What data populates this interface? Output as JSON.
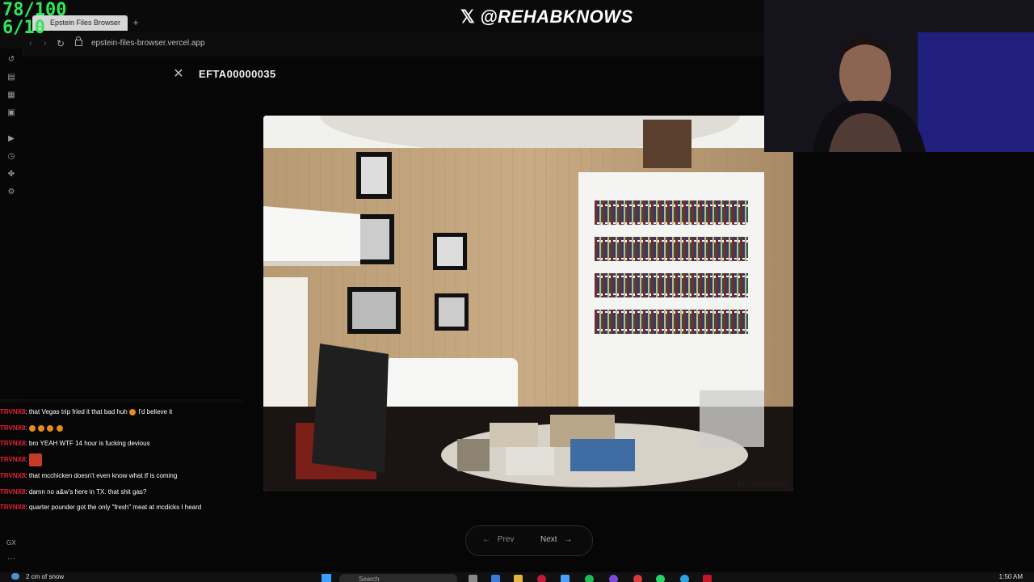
{
  "overlay": {
    "score_line1": "78/100",
    "score_line2": "6/10",
    "social_handle": "@REHABKNOWS",
    "social_icon": "x-logo-icon"
  },
  "browser": {
    "tab_title": "Epstein Files Browser",
    "new_tab": "+",
    "url": "epstein-files-browser.vercel.app"
  },
  "viewer": {
    "document_id": "EFTA00000035",
    "close_symbol": "✕",
    "photo_caption": "EFTA00000035",
    "prev_arrow": "←",
    "prev_label": "Prev",
    "next_label": "Next",
    "next_arrow": "→"
  },
  "chat": {
    "messages": [
      {
        "user": "TRVNX8",
        "sep": ": ",
        "text": "that Vegas trip fried it that bad huh",
        "suffix": " I'd believe it",
        "emojis": 1
      },
      {
        "user": "TRVNX8",
        "sep": ": ",
        "text": "",
        "suffix": "",
        "emojis": 4
      },
      {
        "user": "TRVNX8",
        "sep": ": ",
        "text": "bro YEAH WTF 14 hour is fucking devious",
        "suffix": "",
        "emojis": 0
      },
      {
        "user": "TRVNX8",
        "sep": ": ",
        "text": "",
        "suffix": "",
        "emote": true
      },
      {
        "user": "TRVNX8",
        "sep": ": ",
        "text": "that mcchicken doesn't even know what tf is coming",
        "suffix": "",
        "emojis": 0
      },
      {
        "user": "TRVNX8",
        "sep": ": ",
        "text": "damn no a&w's here in TX. that shit gas?",
        "suffix": "",
        "emojis": 0
      },
      {
        "user": "TRVNX8",
        "sep": ": ",
        "text": "quarter pounder got the only \"fresh\" meat at mcdicks I heard",
        "suffix": "",
        "emojis": 0
      }
    ],
    "user_color": "#e8203a"
  },
  "sidebar_bottom": {
    "gx_label": "GX",
    "more_symbol": "⋯"
  },
  "taskbar": {
    "weather": "2 cm of snow",
    "search_placeholder": "Search",
    "clock": "1:50 AM"
  },
  "colors": {
    "score_green": "#2ee85c",
    "accent_blue": "#3aa0ff"
  }
}
